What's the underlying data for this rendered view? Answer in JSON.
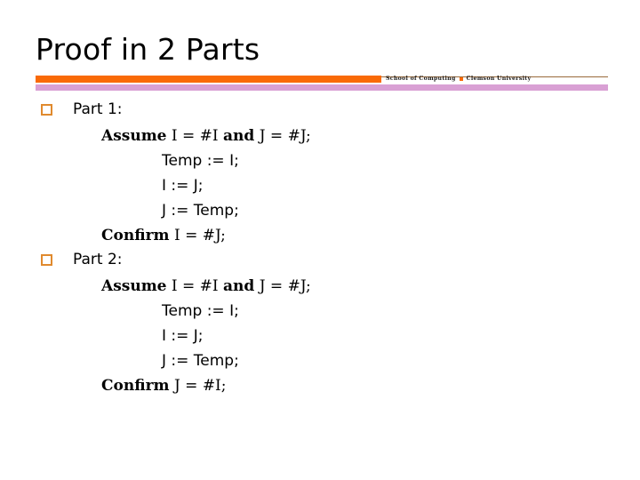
{
  "slide": {
    "title": "Proof in 2 Parts",
    "credit": {
      "school": "School of Computing",
      "separator_icon": "orange-square-bullet",
      "university": "Clemson University"
    },
    "colors": {
      "orange_bar": "#f96a07",
      "pink_bar": "#d9a0d4",
      "thin_rule": "#9a6a3a",
      "bullet_outline": "#e08a2e",
      "text": "#000000",
      "background": "#ffffff"
    },
    "parts": [
      {
        "bullet_icon": "hollow-orange-square-bullet",
        "label": "Part 1:",
        "lines": [
          {
            "keyword": "Assume",
            "rest": " I = #I and J = #J;",
            "indent": "assume",
            "keyword2": "and",
            "full": "Assume I = #I and J = #J;"
          },
          {
            "keyword": "",
            "rest": "Temp := I;",
            "indent": "stmt",
            "full": "Temp := I;"
          },
          {
            "keyword": "",
            "rest": "I := J;",
            "indent": "stmt",
            "full": "I := J;"
          },
          {
            "keyword": "",
            "rest": "J := Temp;",
            "indent": "stmt",
            "full": "J := Temp;"
          },
          {
            "keyword": "Confirm",
            "rest": " I = #J;",
            "indent": "confirm",
            "full": "Confirm I = #J;"
          }
        ]
      },
      {
        "bullet_icon": "hollow-orange-square-bullet",
        "label": "Part 2:",
        "lines": [
          {
            "keyword": "Assume",
            "rest": " I = #I and J = #J;",
            "indent": "assume",
            "keyword2": "and",
            "full": "Assume I = #I and J = #J;"
          },
          {
            "keyword": "",
            "rest": "Temp := I;",
            "indent": "stmt",
            "full": "Temp := I;"
          },
          {
            "keyword": "",
            "rest": "I := J;",
            "indent": "stmt",
            "full": "I := J;"
          },
          {
            "keyword": "",
            "rest": "J := Temp;",
            "indent": "stmt",
            "full": "J := Temp;"
          },
          {
            "keyword": "Confirm",
            "rest": " J = #I;",
            "indent": "confirm",
            "full": "Confirm J = #I;"
          }
        ]
      }
    ],
    "part1": {
      "label": "Part 1:",
      "assume_kw": "Assume",
      "assume_a": " I = #I ",
      "assume_and": "and",
      "assume_b": " J = #J;",
      "stmt1": "Temp := I;",
      "stmt2": "I := J;",
      "stmt3": "J := Temp;",
      "confirm_kw": "Confirm",
      "confirm_rest": " I = #J;"
    },
    "part2": {
      "label": "Part 2:",
      "assume_kw": "Assume",
      "assume_a": " I = #I ",
      "assume_and": "and",
      "assume_b": " J = #J;",
      "stmt1": "Temp := I;",
      "stmt2": "I := J;",
      "stmt3": "J := Temp;",
      "confirm_kw": "Confirm",
      "confirm_rest": " J = #I;"
    }
  }
}
